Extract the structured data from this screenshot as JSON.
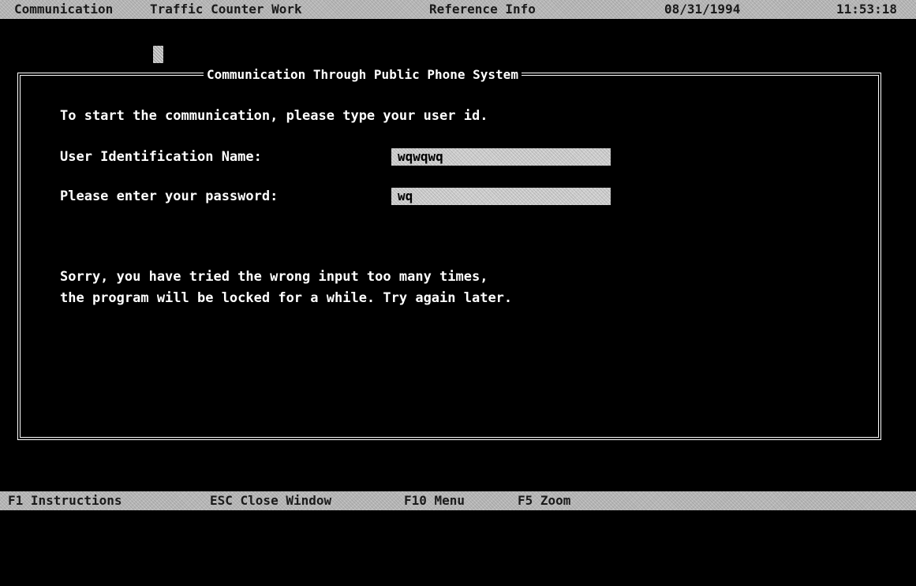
{
  "menu_bar": {
    "items": [
      "Communication",
      "Traffic Counter Work",
      "Reference Info"
    ],
    "date": "08/31/1994",
    "time": "11:53:18"
  },
  "window": {
    "title": "Communication Through Public Phone System"
  },
  "form": {
    "intro": "To start the communication, please type your user id.",
    "user_label": "User Identification Name:",
    "user_value": "wqwqwq",
    "password_label": "Please enter your password:",
    "password_value": "wq"
  },
  "message": {
    "line1": "Sorry, you have tried the wrong input too many times,",
    "line2": "the program will be locked for a while. Try again later."
  },
  "function_bar": {
    "keys": [
      {
        "label": "F1 Instructions"
      },
      {
        "label": "ESC Close Window"
      },
      {
        "label": "F10 Menu"
      },
      {
        "label": "F5 Zoom"
      }
    ]
  }
}
